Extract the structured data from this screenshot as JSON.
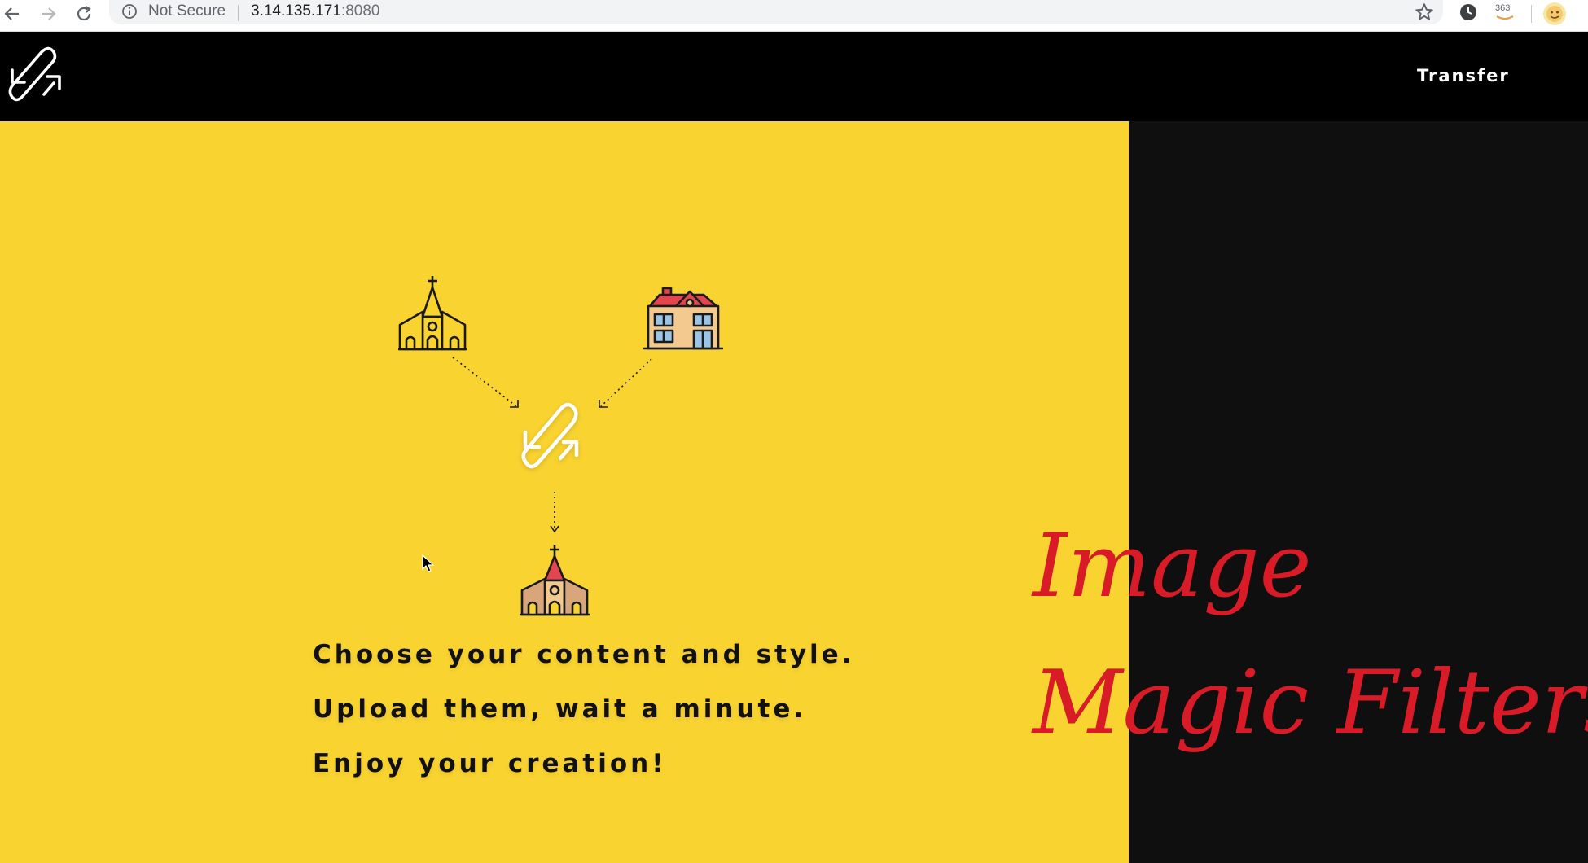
{
  "browser": {
    "security_label": "Not Secure",
    "url_host": "3.14.135.171",
    "url_port": ":8080",
    "extension_badge": "363",
    "icons": [
      "back-arrow-icon",
      "forward-arrow-icon",
      "reload-icon",
      "info-icon",
      "bookmark-star-icon",
      "clock-extension-icon",
      "amazon-extension-icon",
      "profile-avatar-icon"
    ]
  },
  "header": {
    "logo_icon": "transfer-loop-logo-icon",
    "nav_items": [
      {
        "label": "Transfer"
      }
    ]
  },
  "hero": {
    "diagram_icons": [
      "church-icon",
      "house-icon",
      "transfer-loop-icon",
      "styled-church-icon"
    ],
    "steps": [
      "Choose your content and style.",
      "Upload them, wait a minute.",
      "Enjoy your creation!"
    ],
    "brand_lines": [
      "Image",
      "Magic Filters"
    ],
    "colors": {
      "accent_yellow": "#f9d330",
      "brand_red": "#d81b27",
      "dark_panel": "#0f0f0f"
    }
  }
}
